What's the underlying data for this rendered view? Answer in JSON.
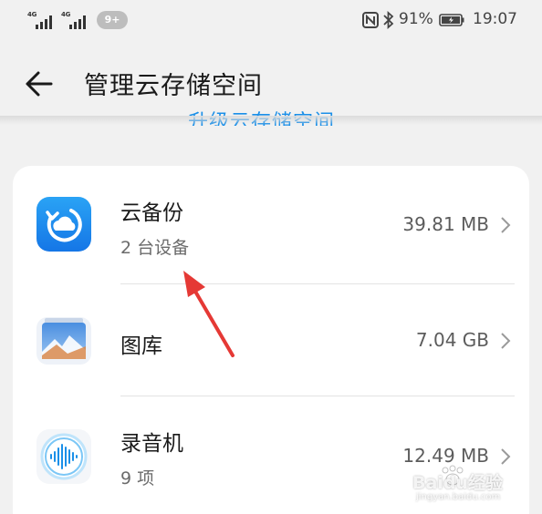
{
  "status_bar": {
    "sim1_network": "4G",
    "sim2_network": "4G",
    "notification_count": "9+",
    "battery_percent": "91%",
    "time": "19:07"
  },
  "header": {
    "title": "管理云存储空间",
    "upgrade_link_partial": "升级云存储空间"
  },
  "storage_items": [
    {
      "name": "云备份",
      "subtitle": "2 台设备",
      "size": "39.81 MB",
      "icon": "cloud-backup-icon"
    },
    {
      "name": "图库",
      "subtitle": "",
      "size": "7.04 GB",
      "icon": "gallery-icon"
    },
    {
      "name": "录音机",
      "subtitle": "9 项",
      "size": "12.49 MB",
      "icon": "recorder-icon"
    }
  ],
  "watermark": {
    "brand": "Baidu经验",
    "url": "jingyan.baidu.com"
  },
  "colors": {
    "accent": "#1a8fe8",
    "background": "#f1f1f1",
    "card": "#ffffff",
    "annotation_arrow": "#e53935"
  }
}
